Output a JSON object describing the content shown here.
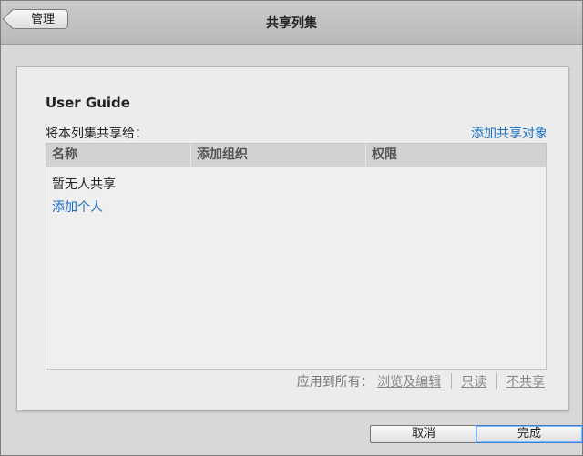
{
  "titlebar": {
    "title": "共享列集",
    "back_label": "管理"
  },
  "panel": {
    "list_name": "User Guide",
    "share_label": "将本列集共享给：",
    "add_share_link": "添加共享对象"
  },
  "table": {
    "columns": [
      "名称",
      "添加组织",
      "权限"
    ],
    "empty_text": "暂无人共享",
    "add_person_link": "添加个人"
  },
  "apply_all": {
    "label": "应用到所有：",
    "options": [
      "浏览及编辑",
      "只读",
      "不共享"
    ]
  },
  "footer": {
    "cancel_label": "取消",
    "done_label": "完成"
  },
  "colors": {
    "link": "#1a6fc4",
    "sheet_bg": "#d8d8d8",
    "panel_bg": "#ececec",
    "header_bg": "#d2d2d2"
  }
}
